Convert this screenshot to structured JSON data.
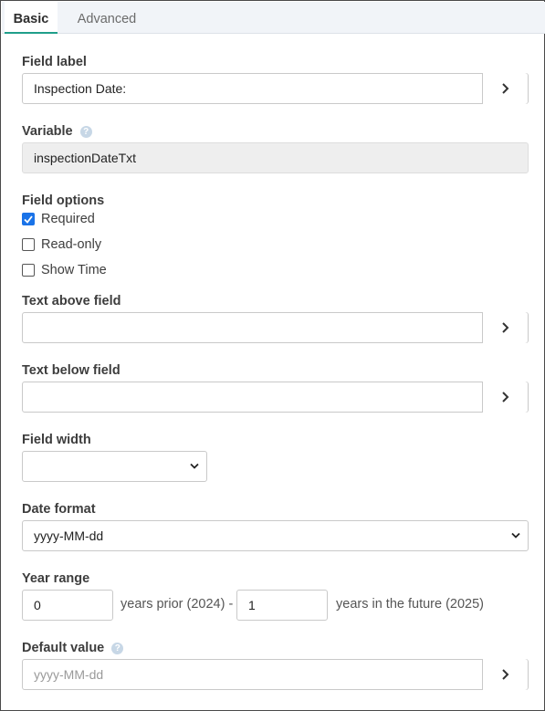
{
  "tabs": [
    {
      "label": "Basic"
    },
    {
      "label": "Advanced"
    }
  ],
  "field_label": {
    "label": "Field label",
    "value": "Inspection Date:"
  },
  "variable": {
    "label": "Variable",
    "value": "inspectionDateTxt",
    "help": "?"
  },
  "field_options": {
    "label": "Field options",
    "items": [
      {
        "label": "Required",
        "checked": true
      },
      {
        "label": "Read-only",
        "checked": false
      },
      {
        "label": "Show Time",
        "checked": false
      }
    ]
  },
  "text_above": {
    "label": "Text above field",
    "value": ""
  },
  "text_below": {
    "label": "Text below field",
    "value": ""
  },
  "field_width": {
    "label": "Field width",
    "value": ""
  },
  "date_format": {
    "label": "Date format",
    "value": "yyyy-MM-dd"
  },
  "year_range": {
    "label": "Year range",
    "prior_value": "0",
    "prior_text": "years prior (2024) -",
    "future_value": "1",
    "future_text": "years in the future (2025)"
  },
  "default_value": {
    "label": "Default value",
    "placeholder": "yyyy-MM-dd",
    "help": "?"
  },
  "colors": {
    "accent": "#1f9e8a",
    "checkbox": "#1a73e8"
  }
}
